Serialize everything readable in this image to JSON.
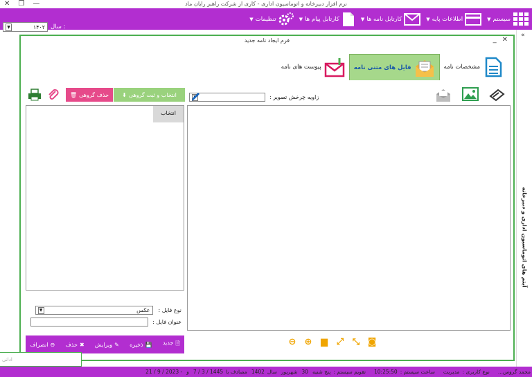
{
  "window": {
    "title": "نرم افزار دبیرخانه و اتوماسیون اداری - کاری از شرکت راهبر رایان ماد"
  },
  "menu": [
    {
      "label": "سیستم",
      "icon": "grid-icon"
    },
    {
      "label": "اطلاعات پایه",
      "icon": "card-icon"
    },
    {
      "label": "کارتابل نامه ها",
      "icon": "mail-icon"
    },
    {
      "label": "کارتابل پیام ها",
      "icon": "document-icon"
    },
    {
      "label": "تنظیمات",
      "icon": "gears-icon"
    }
  ],
  "year": {
    "label": "سال :",
    "value": "۱۴۰۲"
  },
  "side": {
    "label": "آیتم های اتوماسیون اداری و دبیرخانه"
  },
  "form": {
    "title": "فرم ایجاد نامه جدید",
    "tabs": [
      {
        "label": "مشخصات نامه",
        "icon": "document-icon"
      },
      {
        "label": "فایل های متنی نامه",
        "icon": "envelope-open-icon",
        "active": true
      },
      {
        "label": "پیوست های نامه",
        "icon": "envelope-clip-icon"
      }
    ],
    "rotate_label": "زاویه چرخش تصویر :",
    "select_group_btn": "انتخاب و ثبت گروهی",
    "delete_group_btn": "حذف گروهی",
    "list_header": "انتخاب",
    "file_type_label": "نوع فایل :",
    "file_type_value": "عکس",
    "file_title_label": "عنوان فایل :",
    "buttons": {
      "new": "جدید",
      "save": "ذخیره",
      "edit": "ویرایش",
      "delete": "حذف",
      "cancel": "انصراف"
    }
  },
  "footer_left": "ادانی",
  "status": {
    "user": "محمد گروس...",
    "user_type_label": "نوع کاربری :",
    "user_type": "مدیریت",
    "time_label": "ساعت سیستم :",
    "time": "10:25:50",
    "calendar_label": "تقویم سیستم :",
    "day": "پنج شنبه",
    "day_num": "30",
    "month": "شهریور",
    "year_label": "سال",
    "year": "1402",
    "equal_label": "مصادف با",
    "hijri": "7 / 3 / 1445",
    "and": "و",
    "gregorian": "21 / 9 / 2023 -"
  },
  "colors": {
    "accent": "#b22ed0",
    "green": "#4caf50",
    "tab_active": "#a6d88b",
    "pink": "#e64a8a"
  }
}
